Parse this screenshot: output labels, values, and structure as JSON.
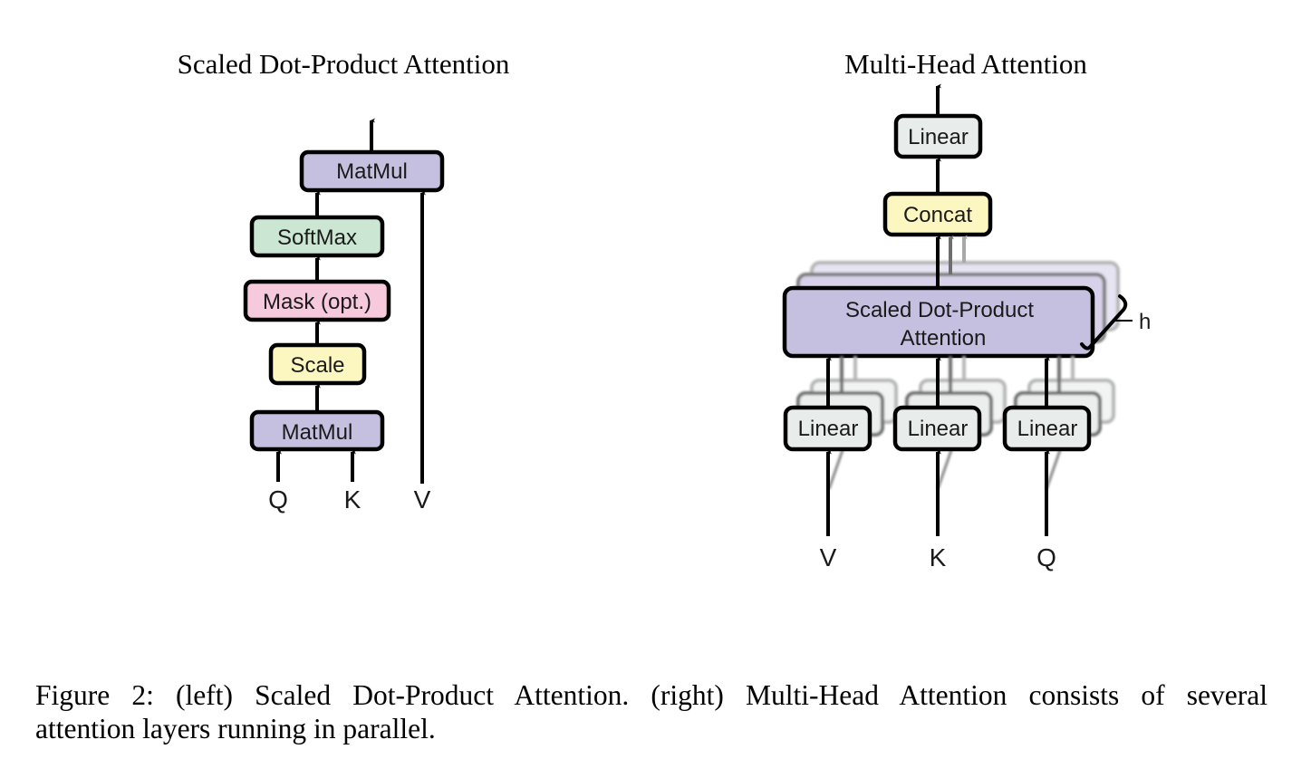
{
  "left_diagram": {
    "title": "Scaled Dot-Product Attention",
    "blocks": [
      {
        "id": "matmul_top",
        "label": "MatMul",
        "color": "#c5bfe0"
      },
      {
        "id": "softmax",
        "label": "SoftMax",
        "color": "#cbe6d2"
      },
      {
        "id": "mask",
        "label": "Mask (opt.)",
        "color": "#f6c9dc"
      },
      {
        "id": "scale",
        "label": "Scale",
        "color": "#fcf7c1"
      },
      {
        "id": "matmul_bottom",
        "label": "MatMul",
        "color": "#c5bfe0"
      }
    ],
    "inputs": [
      "Q",
      "K",
      "V"
    ]
  },
  "right_diagram": {
    "title": "Multi-Head Attention",
    "blocks": [
      {
        "id": "linear_out",
        "label": "Linear",
        "color": "#e8ecea"
      },
      {
        "id": "concat",
        "label": "Concat",
        "color": "#fcf7c1"
      },
      {
        "id": "sdpa",
        "label_line1": "Scaled Dot-Product",
        "label_line2": "Attention",
        "color": "#c5bfe0"
      },
      {
        "id": "linear_v",
        "label": "Linear",
        "color": "#e8ecea"
      },
      {
        "id": "linear_k",
        "label": "Linear",
        "color": "#e8ecea"
      },
      {
        "id": "linear_q",
        "label": "Linear",
        "color": "#e8ecea"
      }
    ],
    "heads_label": "h",
    "inputs": [
      "V",
      "K",
      "Q"
    ]
  },
  "caption": {
    "line1": "Figure 2:  (left) Scaled Dot-Product Attention.  (right) Multi-Head Attention consists of several",
    "line2": "attention layers running in parallel."
  }
}
